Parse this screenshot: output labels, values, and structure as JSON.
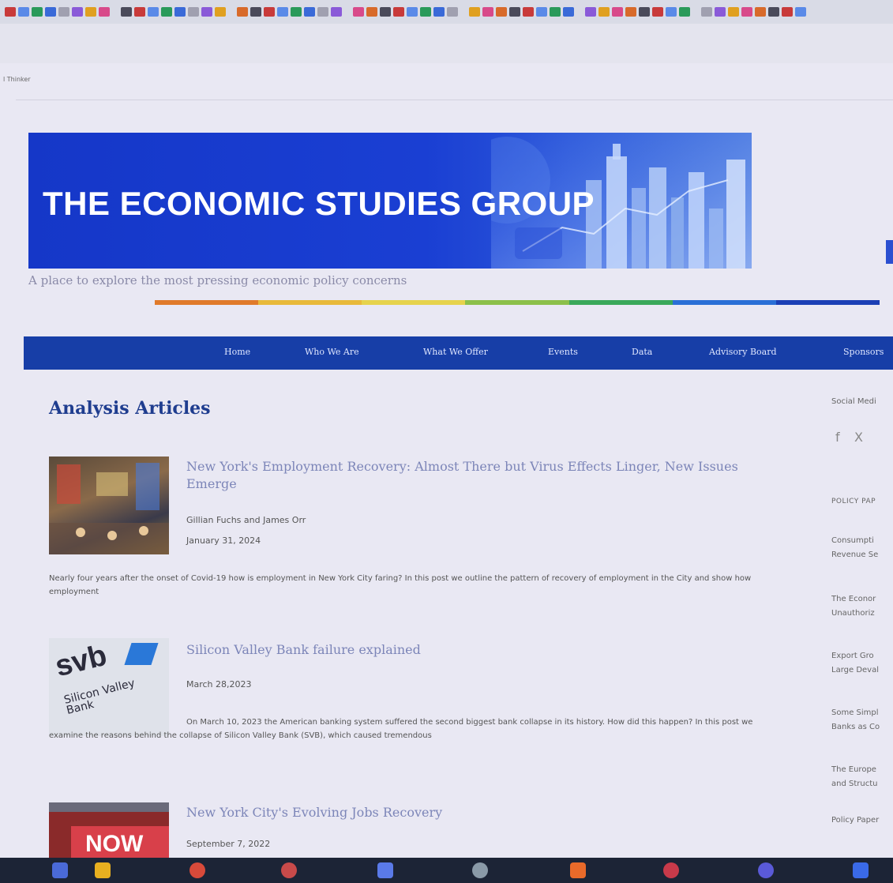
{
  "browser": {
    "tab_fragment": "l Thinker"
  },
  "header": {
    "title": "THE ECONOMIC STUDIES GROUP",
    "tagline": "A place to explore the most pressing economic policy concerns",
    "rule_colors": [
      "#e07a2a",
      "#e8b93a",
      "#e6d24c",
      "#8cc04a",
      "#3aa85a",
      "#2a6fd6",
      "#1b3fb5"
    ]
  },
  "nav": {
    "items": [
      "Home",
      "Who We Are",
      "What We Offer",
      "Events",
      "Data",
      "Advisory Board",
      "Sponsors"
    ]
  },
  "main": {
    "section_title": "Analysis Articles",
    "articles": [
      {
        "title": "New York's Employment Recovery: Almost There but Virus Effects Linger, New Issues Emerge",
        "authors": "Gillian Fuchs and James Orr",
        "date": "January 31, 2024",
        "excerpt": "Nearly four years after the onset of Covid-19 how is employment in New York City faring? In this post we outline the pattern of recovery of employment in the City and show how employment"
      },
      {
        "title": "Silicon Valley Bank failure explained",
        "date": "March 28,2023",
        "excerpt": "On March 10, 2023 the American banking system suffered the second biggest bank collapse in its history. How did this happen? In this post we examine the reasons behind the collapse of Silicon Valley Bank (SVB), which caused tremendous",
        "thumb_text_1": "svb",
        "thumb_text_2": "Silicon Valley",
        "thumb_text_3": "Bank"
      },
      {
        "title": "New York City's Evolving Jobs Recovery",
        "date": "September 7, 2022",
        "thumb_text": "NOW"
      }
    ]
  },
  "sidebar": {
    "social_label": "Social Medi",
    "social_icons": [
      "facebook-icon",
      "x-icon"
    ],
    "social_glyphs": [
      "f",
      "X"
    ],
    "policy_label": "POLICY PAP",
    "items": [
      {
        "line1": "Consumpti",
        "line2": "Revenue Se"
      },
      {
        "line1": "The Econor",
        "line2": "Unauthoriz"
      },
      {
        "line1": "Export Gro",
        "line2": "Large Deval"
      },
      {
        "line1": "Some Simpl",
        "line2": "Banks as Co"
      },
      {
        "line1": "The Europe",
        "line2": "and Structu"
      }
    ],
    "policy_papers_link": "Policy Paper"
  },
  "colors": {
    "banner_blue": "#1a3fd3",
    "nav_blue": "#173ea7",
    "title_blue": "#1f3d8f",
    "link_lavender": "#7c85b8"
  }
}
